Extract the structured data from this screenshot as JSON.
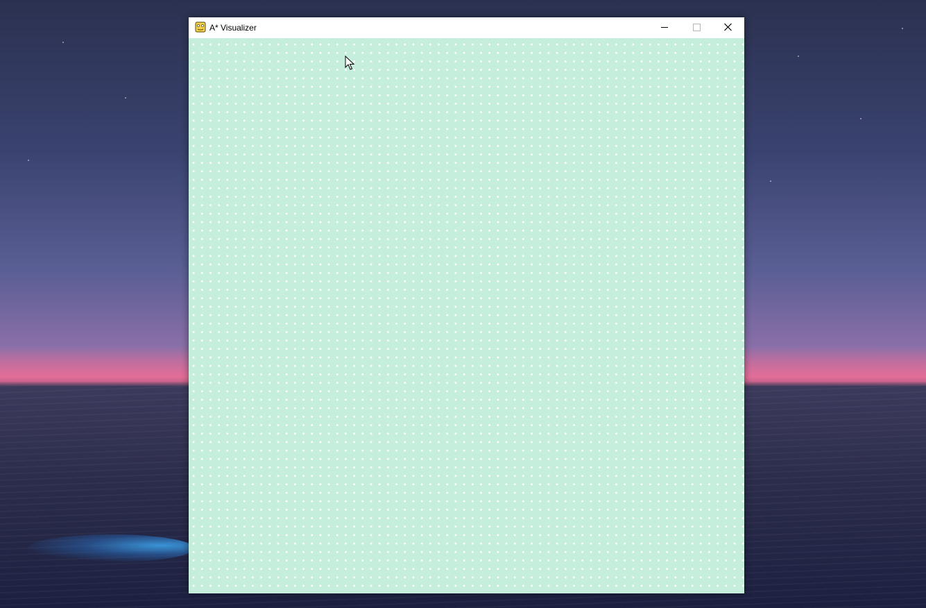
{
  "window": {
    "title": "A* Visualizer",
    "icon": "python-snake-icon"
  },
  "titlebar_buttons": {
    "minimize": "minimize-icon",
    "maximize": "maximize-icon",
    "close": "close-icon"
  },
  "grid": {
    "background_color": "#c5eedc",
    "dot_color": "#ffffff"
  },
  "cursor": {
    "icon": "arrow-cursor-icon"
  }
}
